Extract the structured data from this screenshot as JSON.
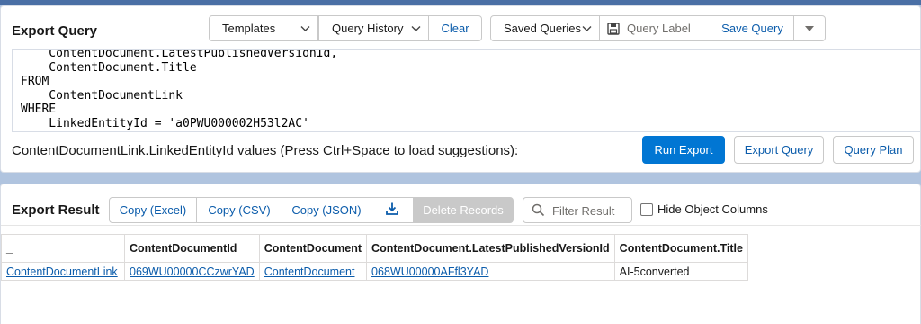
{
  "query_panel": {
    "title": "Export Query",
    "templates_label": "Templates",
    "query_history_label": "Query History",
    "clear_label": "Clear",
    "saved_queries_label": "Saved Queries",
    "query_label_placeholder": "Query Label",
    "save_query_label": "Save Query",
    "editor_lines": [
      "    ContentDocument.LatestPublishedVersionId,",
      "    ContentDocument.Title",
      "FROM",
      "    ContentDocumentLink",
      "WHERE",
      "    LinkedEntityId = 'a0PWU000002H53l2AC'"
    ],
    "hint": "ContentDocumentLink.LinkedEntityId values (Press Ctrl+Space to load suggestions):",
    "run_export_label": "Run Export",
    "export_query_label": "Export Query",
    "query_plan_label": "Query Plan"
  },
  "result_panel": {
    "title": "Export Result",
    "copy_excel_label": "Copy (Excel)",
    "copy_csv_label": "Copy (CSV)",
    "copy_json_label": "Copy (JSON)",
    "delete_records_label": "Delete Records",
    "filter_placeholder": "Filter Result",
    "hide_columns_label": "Hide Object Columns",
    "columns": [
      "_",
      "ContentDocumentId",
      "ContentDocument",
      "ContentDocument.LatestPublishedVersionId",
      "ContentDocument.Title"
    ],
    "rows": [
      {
        "c0": "ContentDocumentLink",
        "c1": "069WU00000CCzwrYAD",
        "c2": "ContentDocument",
        "c3": "068WU00000AFfl3YAD",
        "c4": "AI-5converted"
      }
    ]
  },
  "colors": {
    "accent": "#0176d3",
    "link": "#0b5cab",
    "background": "#b0c4df"
  }
}
